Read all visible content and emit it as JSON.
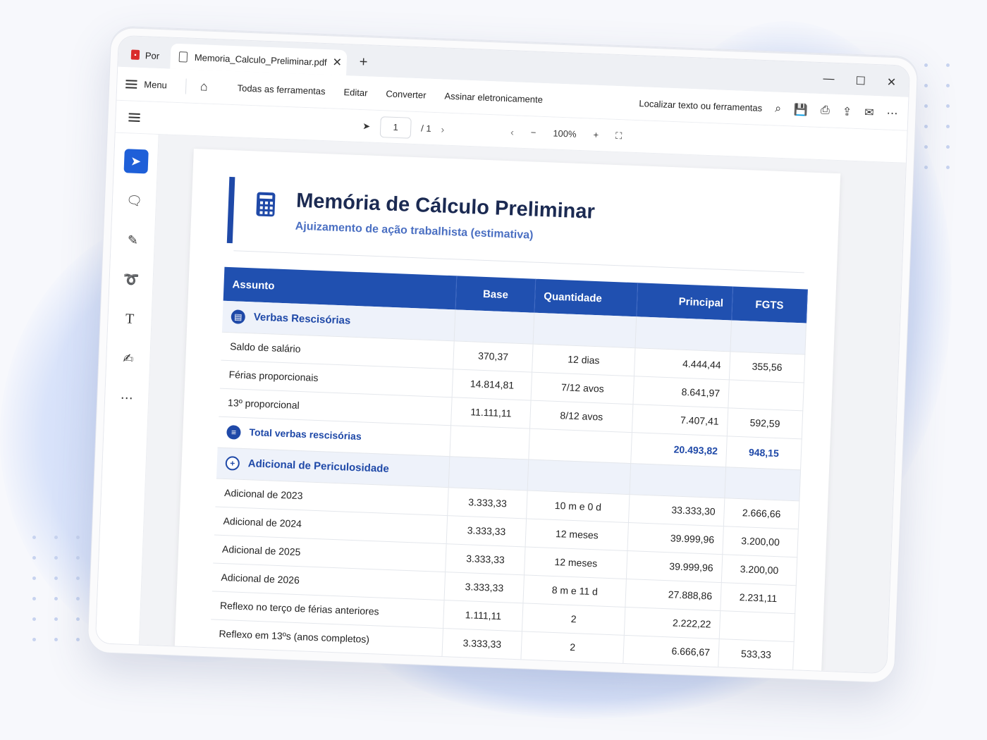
{
  "browser": {
    "tabs": [
      {
        "label": "Por",
        "icon": "pdf-icon"
      },
      {
        "label": "Memoria_Calculo_Preliminar.pdf",
        "icon": "document-icon"
      }
    ]
  },
  "menubar": {
    "menu_label": "Menu",
    "items": [
      "Todas as ferramentas",
      "Editar",
      "Converter",
      "Assinar eletronicamente"
    ],
    "search_label": "Localizar texto ou ferramentas"
  },
  "subbar": {
    "page_current": "1",
    "page_total": "/ 1",
    "zoom": "100%"
  },
  "document": {
    "title": "Memória de Cálculo Preliminar",
    "subtitle": "Ajuizamento de ação trabalhista (estimativa)",
    "columns": [
      "Assunto",
      "Base",
      "Quantidade",
      "Principal",
      "FGTS"
    ],
    "section1": {
      "title": "Verbas Rescisórias",
      "rows": [
        {
          "assunto": "Saldo de salário",
          "base": "370,37",
          "qtd": "12 dias",
          "principal": "4.444,44",
          "fgts": "355,56"
        },
        {
          "assunto": "Férias proporcionais",
          "base": "14.814,81",
          "qtd": "7/12 avos",
          "principal": "8.641,97",
          "fgts": ""
        },
        {
          "assunto": "13º proporcional",
          "base": "11.111,11",
          "qtd": "8/12 avos",
          "principal": "7.407,41",
          "fgts": "592,59"
        }
      ],
      "total": {
        "label": "Total verbas rescisórias",
        "principal": "20.493,82",
        "fgts": "948,15"
      }
    },
    "section2": {
      "title": "Adicional de Periculosidade",
      "rows": [
        {
          "assunto": "Adicional de 2023",
          "base": "3.333,33",
          "qtd": "10 m e 0 d",
          "principal": "33.333,30",
          "fgts": "2.666,66"
        },
        {
          "assunto": "Adicional de 2024",
          "base": "3.333,33",
          "qtd": "12 meses",
          "principal": "39.999,96",
          "fgts": "3.200,00"
        },
        {
          "assunto": "Adicional de 2025",
          "base": "3.333,33",
          "qtd": "12 meses",
          "principal": "39.999,96",
          "fgts": "3.200,00"
        },
        {
          "assunto": "Adicional de 2026",
          "base": "3.333,33",
          "qtd": "8 m e 11 d",
          "principal": "27.888,86",
          "fgts": "2.231,11"
        },
        {
          "assunto": "Reflexo no terço de férias anteriores",
          "base": "1.111,11",
          "qtd": "2",
          "principal": "2.222,22",
          "fgts": ""
        },
        {
          "assunto": "Reflexo em 13ºs (anos completos)",
          "base": "3.333,33",
          "qtd": "2",
          "principal": "6.666,67",
          "fgts": "533,33"
        }
      ]
    }
  },
  "colors": {
    "accent": "#1f49a8",
    "header_bg": "#2050b0",
    "tool_active": "#1e5fd8"
  }
}
